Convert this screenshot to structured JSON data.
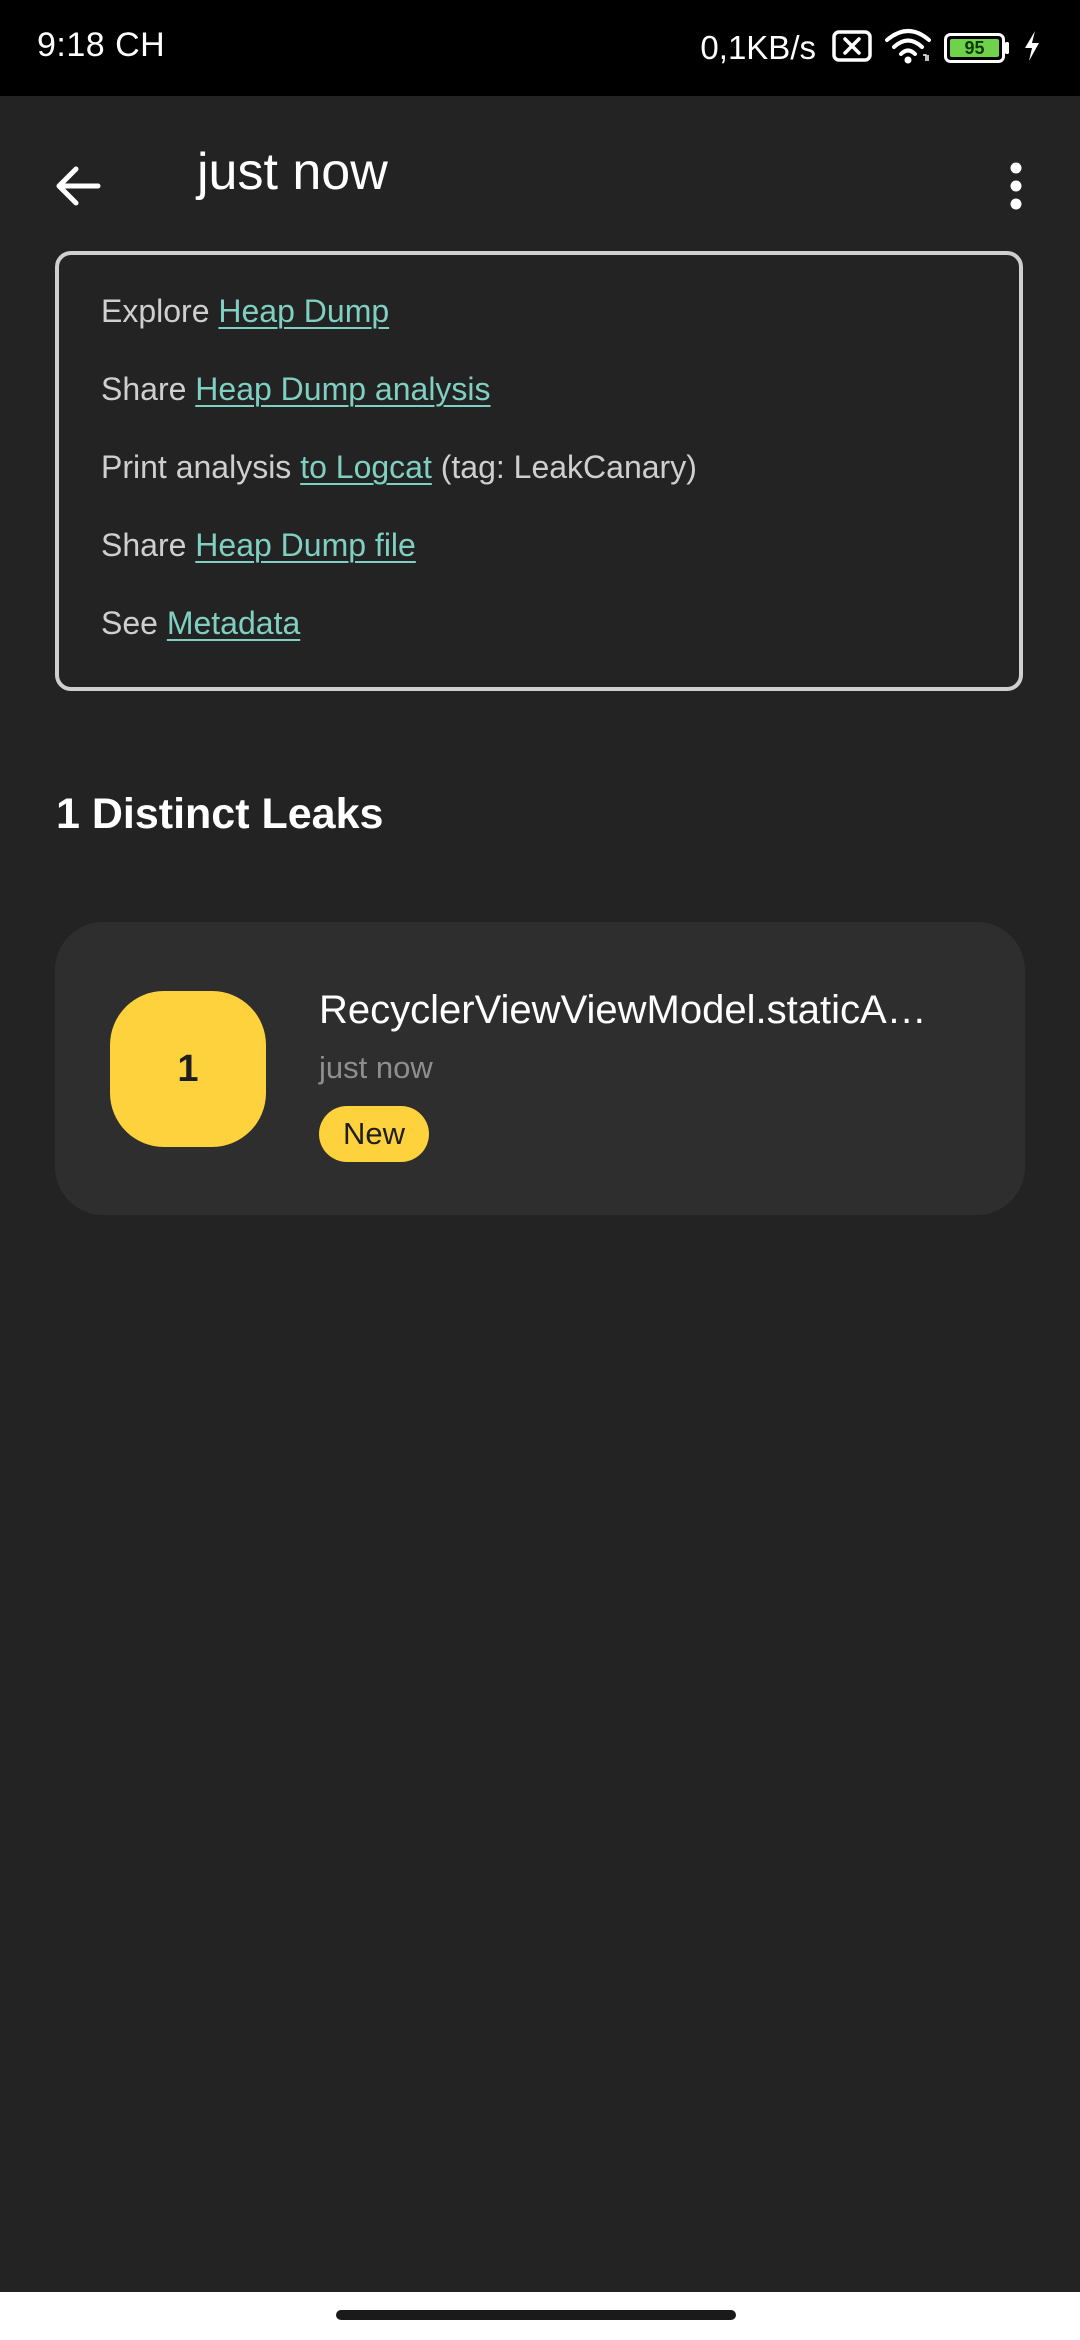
{
  "status_bar": {
    "time": "9:18 CH",
    "net_speed": "0,1KB/s",
    "battery_level": "95",
    "icons": [
      "sim-no-signal-icon",
      "wifi-icon",
      "battery-icon",
      "charging-icon"
    ]
  },
  "toolbar": {
    "title": "just now",
    "back_icon": "arrow-left-icon",
    "menu_icon": "more-vert-icon"
  },
  "links": [
    {
      "prefix": "Explore ",
      "link": "Heap Dump",
      "suffix": ""
    },
    {
      "prefix": "Share ",
      "link": "Heap Dump analysis",
      "suffix": ""
    },
    {
      "prefix": "Print analysis ",
      "link": "to Logcat",
      "suffix": " (tag: LeakCanary)"
    },
    {
      "prefix": "Share ",
      "link": "Heap Dump file",
      "suffix": ""
    },
    {
      "prefix": "See ",
      "link": "Metadata",
      "suffix": ""
    }
  ],
  "section": {
    "title": "1 Distinct Leaks"
  },
  "leaks": [
    {
      "count": "1",
      "title": "RecyclerViewViewModel.staticA…",
      "time": "just now",
      "badge": "New"
    }
  ],
  "colors": {
    "background": "#232323",
    "link": "#7fd0c2",
    "accent": "#fdd23c",
    "card": "#2e2e2e"
  }
}
